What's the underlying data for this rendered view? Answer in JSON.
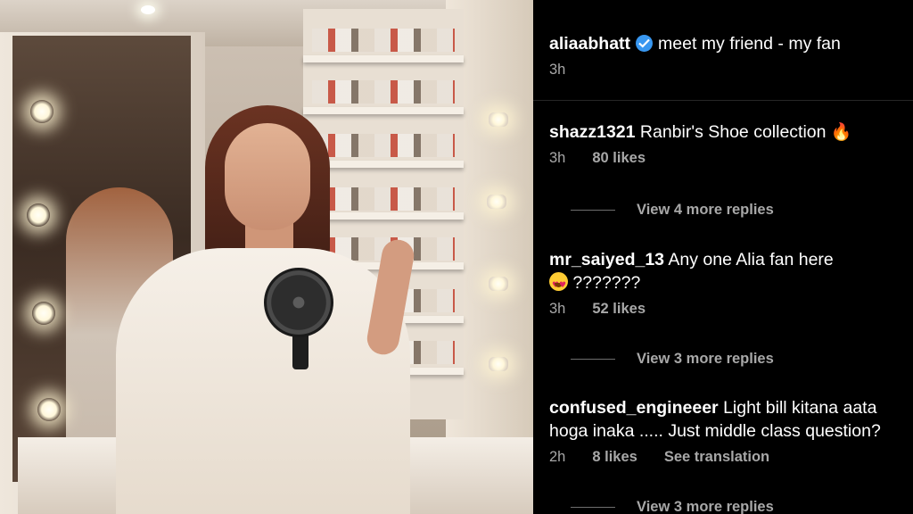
{
  "post": {
    "author": "aliaabhatt",
    "caption": "meet my friend - my fan",
    "time": "3h",
    "verified_icon": "verified-badge-icon"
  },
  "comments": [
    {
      "user": "shazz1321",
      "text": "Ranbir's Shoe collection",
      "emoji": "fire-icon",
      "time": "3h",
      "likes": "80 likes",
      "replies": "View 4 more replies"
    },
    {
      "user": "mr_saiyed_13",
      "text": "Any one Alia fan here",
      "line2": "???????",
      "emoji": "heart-eyes-icon",
      "time": "3h",
      "likes": "52 likes",
      "replies": "View 3 more replies"
    },
    {
      "user": "confused_engineeer",
      "text": "Light bill kitana aata",
      "line2": "hoga inaka ..... Just middle class question?",
      "time": "2h",
      "likes": "8 likes",
      "see_translation": "See translation",
      "replies": "View 3 more replies"
    }
  ],
  "colors": {
    "background": "#000000",
    "text": "#ffffff",
    "muted": "#a8a8a8",
    "verified": "#3897f0"
  }
}
